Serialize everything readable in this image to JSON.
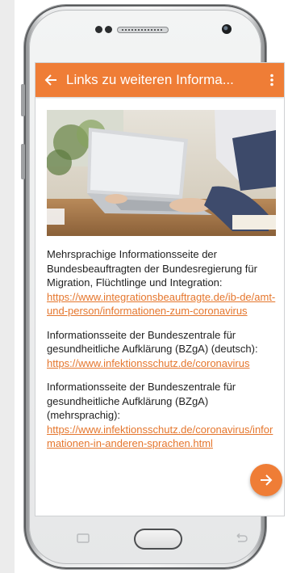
{
  "appbar": {
    "title": "Links zu weiteren Informa...",
    "back_icon": "arrow-left-icon",
    "menu_icon": "more-vert-icon"
  },
  "hero_image": "laptop-typing-photo",
  "entries": [
    {
      "text": "Mehrsprachige Informationsseite der Bundesbeauftragten der Bundesregierung für Migration, Flüchtlinge und Integration:",
      "link": "https://www.integrationsbeauftragte.de/ib-de/amt-und-person/informationen-zum-coronavirus"
    },
    {
      "text": "Informationsseite der Bundeszentrale für gesundheitliche Aufklärung (BZgA) (deutsch):",
      "link": "https://www.infektionsschutz.de/coronavirus"
    },
    {
      "text": "Informationsseite der Bundeszentrale für gesundheitliche Aufklärung (BZgA) (mehrsprachig):",
      "link": "https://www.infektionsschutz.de/coronavirus/informationen-in-anderen-sprachen.html"
    }
  ],
  "fab_icon": "arrow-right-icon",
  "colors": {
    "accent": "#ef7d36",
    "link": "#e5762d"
  }
}
